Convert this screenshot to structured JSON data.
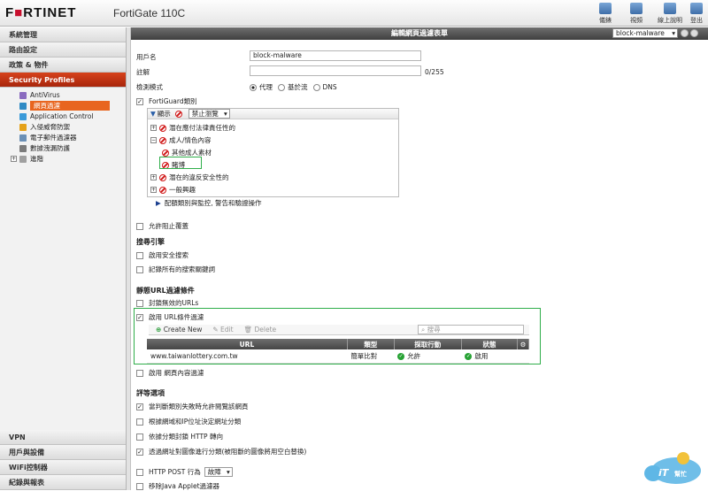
{
  "header": {
    "logo": "F RTINET",
    "model": "FortiGate 110C",
    "buttons": [
      {
        "label": "儀錶",
        "icon": "dashboard-icon"
      },
      {
        "label": "視頻",
        "icon": "video-icon"
      },
      {
        "label": "線上說明",
        "icon": "help-icon"
      },
      {
        "label": "登出",
        "icon": "logout-icon"
      }
    ]
  },
  "sidebar": {
    "sections": [
      "系統管理",
      "路由設定",
      "政策 & 物件",
      "Security Profiles"
    ],
    "items": [
      "AntiVirus",
      "網頁過濾",
      "Application Control",
      "入侵威脅防禦",
      "電子郵件過濾器",
      "數據洩漏防護",
      "進階"
    ],
    "bottom_sections": [
      "VPN",
      "用戶與設備",
      "WiFi控制器",
      "紀錄與報表"
    ]
  },
  "main": {
    "title": "編輯網頁過濾表單",
    "profile_select": "block-malware",
    "name_label": "用戶名",
    "name_value": "block-malware",
    "comment_label": "註解",
    "comment_counter": "0/255",
    "mode_label": "檢測模式",
    "modes": [
      "代理",
      "基於流",
      "DNS"
    ],
    "fortiguard_label": "FortiGuard類別",
    "tree_toolbar": {
      "show": "顯示",
      "action": "禁止瀏覽"
    },
    "tree": [
      "潛在應付法律責任性的",
      "成人/情色內容",
      "其他成人素材",
      "賭博",
      "潛在的違反安全性的",
      "一般興趣"
    ],
    "tree_link": "配額類別與監控, 警告和驗證操作",
    "allow_override": "允許阻止覆蓋",
    "search_engine_section": "搜尋引擎",
    "safe_search": "啟用安全搜索",
    "log_keywords": "記錄所有的搜索關鍵詞",
    "static_url_section": "靜態URL過濾條件",
    "block_invalid_urls": "封鎖無效的URLs",
    "enable_url_filter": "啟用 URL條件過濾",
    "url_toolbar": {
      "create": "Create New",
      "edit": "Edit",
      "delete": "Delete",
      "search_placeholder": "搜尋"
    },
    "url_table": {
      "headers": [
        "URL",
        "類型",
        "採取行動",
        "狀態"
      ],
      "rows": [
        {
          "url": "www.taiwanlottery.com.tw",
          "type": "簡單比對",
          "action": "允許",
          "status": "啟用"
        }
      ]
    },
    "content_filter": "啟用 網頁內容過濾",
    "rating_section": "評等選項",
    "rating_options": [
      "當判斷類別失敗時允許閱覽該網頁",
      "根據網域和IP位址決定網址分類",
      "依據分類封鎖 HTTP 轉向",
      "透過網址對圖像進行分類(被阻斷的圖像將用空白替換)"
    ],
    "http_post_label": "HTTP POST 行為",
    "http_post_value": "故障",
    "java_applet": "移除Java Applet過濾器"
  }
}
